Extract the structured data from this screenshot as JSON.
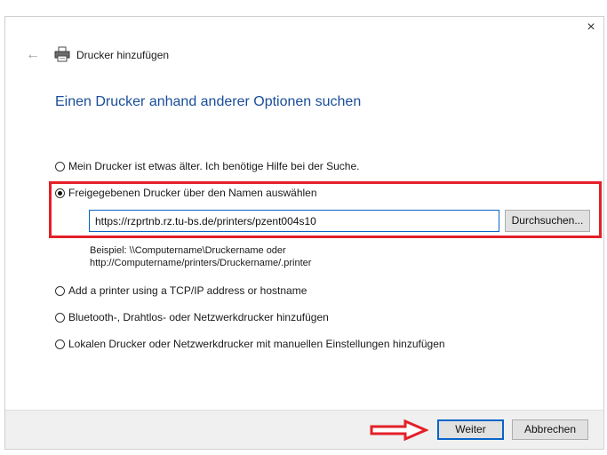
{
  "window": {
    "title": "Drucker hinzufügen",
    "close_glyph": "×",
    "back_glyph": "←",
    "icons": {
      "back": "back-arrow-icon",
      "printer": "printer-icon",
      "close": "close-icon"
    }
  },
  "main": {
    "heading": "Einen Drucker anhand anderer Optionen suchen",
    "options": [
      {
        "label": "Mein Drucker ist etwas älter. Ich benötige Hilfe bei der Suche.",
        "checked": false
      },
      {
        "label": "Freigegebenen Drucker über den Namen auswählen",
        "checked": true
      },
      {
        "label": "Add a printer using a TCP/IP address or hostname",
        "checked": false
      },
      {
        "label": "Bluetooth-, Drahtlos- oder Netzwerkdrucker hinzufügen",
        "checked": false
      },
      {
        "label": "Lokalen Drucker oder Netzwerkdrucker mit manuellen Einstellungen hinzufügen",
        "checked": false
      }
    ],
    "printer_url": "https://rzprtnb.rz.tu-bs.de/printers/pzent004s10",
    "browse_label": "Durchsuchen...",
    "example_line1": "Beispiel: \\\\Computername\\Druckername oder",
    "example_line2": "http://Computername/printers/Druckername/.printer"
  },
  "footer": {
    "next_label": "Weiter",
    "cancel_label": "Abbrechen"
  },
  "colors": {
    "accent": "#0a64c8",
    "heading": "#1a4e9a",
    "annotation_red": "#e32028"
  }
}
